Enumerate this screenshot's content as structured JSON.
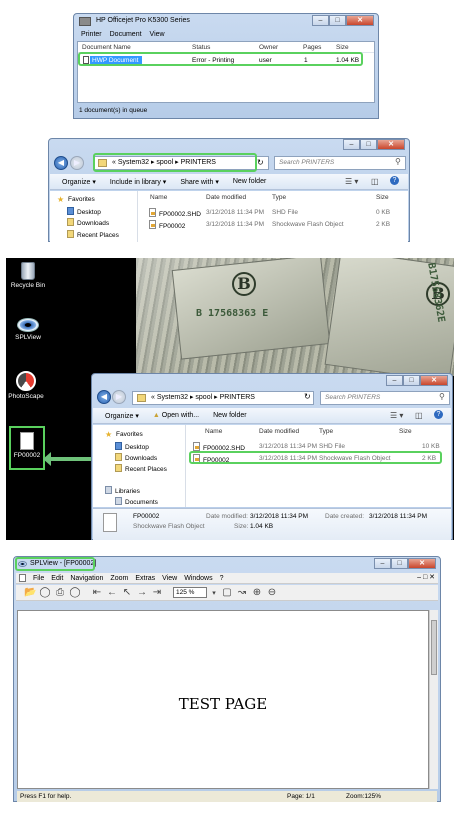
{
  "print_queue": {
    "title": "HP Officejet Pro K5300 Series",
    "menu": [
      "Printer",
      "Document",
      "View"
    ],
    "columns": [
      "Document Name",
      "Status",
      "Owner",
      "Pages",
      "Size"
    ],
    "row": {
      "name": "HWP Document",
      "status": "Error - Printing",
      "owner": "user",
      "pages": "1",
      "size": "1.04 KB"
    },
    "status": "1 document(s) in queue"
  },
  "explorer1": {
    "breadcrumb": [
      "«",
      "System32",
      "▸",
      "spool",
      "▸",
      "PRINTERS"
    ],
    "search_placeholder": "Search PRINTERS",
    "toolbar": [
      "Organize ▾",
      "Include in library ▾",
      "Share with ▾",
      "New folder"
    ],
    "nav": [
      "Favorites",
      "Desktop",
      "Downloads",
      "Recent Places"
    ],
    "columns": [
      "Name",
      "Date modified",
      "Type",
      "Size"
    ],
    "files": [
      {
        "name": "FP00002.SHD",
        "date": "3/12/2018 11:34 PM",
        "type": "SHD File",
        "size": "0 KB"
      },
      {
        "name": "FP00002",
        "date": "3/12/2018 11:34 PM",
        "type": "Shockwave Flash Object",
        "size": "2 KB"
      }
    ]
  },
  "desktop": {
    "icons": [
      "Recycle Bin",
      "SPLView",
      "PhotoScape"
    ],
    "file_icon": "FP00002",
    "money": {
      "seal1": "B",
      "serial1": "B 17568363 E",
      "seal2": "B",
      "serial2": "B17568362E"
    }
  },
  "explorer2": {
    "breadcrumb": [
      "«",
      "System32",
      "▸",
      "spool",
      "▸",
      "PRINTERS"
    ],
    "search_placeholder": "Search PRINTERS",
    "toolbar": [
      "Organize ▾",
      "Open with...",
      "New folder"
    ],
    "nav": [
      "Favorites",
      "Desktop",
      "Downloads",
      "Recent Places",
      "Libraries",
      "Documents"
    ],
    "columns": [
      "Name",
      "Date modified",
      "Type",
      "Size"
    ],
    "files": [
      {
        "name": "FP00002.SHD",
        "date": "3/12/2018 11:34 PM",
        "type": "SHD File",
        "size": "10 KB"
      },
      {
        "name": "FP00002",
        "date": "3/12/2018 11:34 PM",
        "type": "Shockwave Flash Object",
        "size": "2 KB"
      }
    ],
    "details": {
      "name": "FP00002",
      "type": "Shockwave Flash Object",
      "modified_label": "Date modified:",
      "modified": "3/12/2018 11:34 PM",
      "created_label": "Date created:",
      "created": "3/12/2018 11:34 PM",
      "size_label": "Size:",
      "size": "1.04 KB"
    }
  },
  "splview": {
    "title": "SPLView - [FP00002]",
    "menu": [
      "File",
      "Edit",
      "Navigation",
      "Zoom",
      "Extras",
      "View",
      "Windows",
      "?"
    ],
    "zoom_value": "125 %",
    "page_text": "TEST PAGE",
    "status_left": "Press F1 for help.",
    "status_page": "Page: 1/1",
    "status_zoom": "Zoom:125%"
  },
  "colors": {
    "highlight": "#5ad15e",
    "selection": "#3399ff"
  }
}
